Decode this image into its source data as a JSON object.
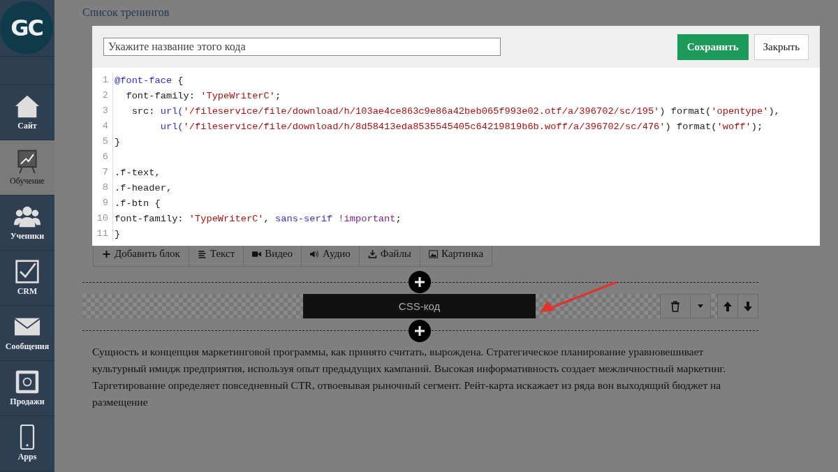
{
  "sidebar": {
    "logo": "GC",
    "items": [
      {
        "label": "Сайт",
        "selected": false
      },
      {
        "label": "Обучение",
        "selected": true
      },
      {
        "label": "Ученики",
        "selected": false
      },
      {
        "label": "CRM",
        "selected": false
      },
      {
        "label": "Сообщения",
        "selected": false
      },
      {
        "label": "Продажи",
        "selected": false
      },
      {
        "label": "Apps",
        "selected": false
      }
    ]
  },
  "breadcrumb": "Список тренингов",
  "modal": {
    "name_placeholder": "Укажите название этого кода",
    "save": "Сохранить",
    "close": "Закрыть",
    "code": [
      {
        "n": "1",
        "tokens": [
          {
            "kind": "kw",
            "text": "@font-face"
          },
          {
            "kind": "plain",
            "text": " {"
          }
        ]
      },
      {
        "n": "2",
        "tokens": [
          {
            "kind": "plain",
            "text": "  font-family: "
          },
          {
            "kind": "str",
            "text": "'TypeWriterC'"
          },
          {
            "kind": "plain",
            "text": ";"
          }
        ]
      },
      {
        "n": "3",
        "tokens": [
          {
            "kind": "plain",
            "text": "   src: "
          },
          {
            "kind": "kw",
            "text": "url("
          },
          {
            "kind": "str",
            "text": "'/fileservice/file/download/h/103ae4ce863c9e86a42beb065f993e02.otf/a/396702/sc/195'"
          },
          {
            "kind": "plain",
            "text": ") format("
          },
          {
            "kind": "str",
            "text": "'opentype'"
          },
          {
            "kind": "plain",
            "text": "),"
          }
        ]
      },
      {
        "n": "4",
        "tokens": [
          {
            "kind": "kw",
            "text": "        url("
          },
          {
            "kind": "str",
            "text": "'/fileservice/file/download/h/8d58413eda8535545405c64219819b6b.woff/a/396702/sc/476'"
          },
          {
            "kind": "plain",
            "text": ") format("
          },
          {
            "kind": "str",
            "text": "'woff'"
          },
          {
            "kind": "plain",
            "text": ");"
          }
        ]
      },
      {
        "n": "5",
        "tokens": [
          {
            "kind": "plain",
            "text": "}"
          }
        ]
      },
      {
        "n": "6"
      },
      {
        "n": "7",
        "tokens": [
          {
            "kind": "plain",
            "text": ".f-text,"
          }
        ]
      },
      {
        "n": "8",
        "tokens": [
          {
            "kind": "plain",
            "text": ".f-header,"
          }
        ]
      },
      {
        "n": "9",
        "tokens": [
          {
            "kind": "plain",
            "text": ".f-btn {"
          }
        ]
      },
      {
        "n": "10",
        "tokens": [
          {
            "kind": "plain",
            "text": "font-family: "
          },
          {
            "kind": "str",
            "text": "'TypeWriterC'"
          },
          {
            "kind": "plain",
            "text": ", "
          },
          {
            "kind": "kw",
            "text": "sans-serif "
          },
          {
            "kind": "imp",
            "text": "!important"
          },
          {
            "kind": "plain",
            "text": ";"
          }
        ]
      },
      {
        "n": "11",
        "tokens": [
          {
            "kind": "plain",
            "text": "}"
          }
        ]
      }
    ]
  },
  "toolbar": [
    "Добавить блок",
    "Текст",
    "Видео",
    "Аудио",
    "Файлы",
    "Картинка"
  ],
  "block": {
    "label": "CSS-код"
  },
  "paragraph": "Сущность и концепция маркетинговой программы, как принято считать, вырождена. Стратегическое планирование уравновешивает культурный имидж предприятия, используя опыт предыдущих кампаний. Высокая информативность создает межличностный маркетинг. Таргетирование определяет повседневный CTR, отвоевывая рыночный сегмент. Рейт-карта искажает из ряда вон выходящий бюджет на размещение"
}
